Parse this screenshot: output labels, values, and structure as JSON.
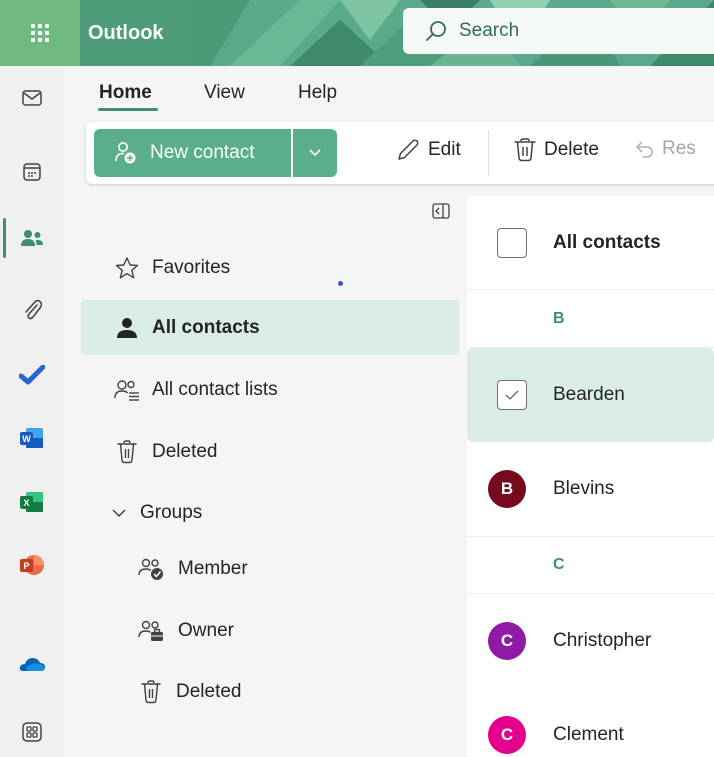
{
  "header": {
    "app_name": "Outlook",
    "search": {
      "label": "Search"
    }
  },
  "rail": {
    "items": [
      {
        "icon": "mail-icon"
      },
      {
        "icon": "calendar-icon"
      },
      {
        "icon": "people-icon",
        "active": true
      },
      {
        "icon": "attach-icon"
      },
      {
        "icon": "todo-icon"
      },
      {
        "icon": "word-icon",
        "letter": "W"
      },
      {
        "icon": "excel-icon",
        "letter": "X"
      },
      {
        "icon": "powerpoint-icon",
        "letter": "P"
      },
      {
        "icon": "onedrive-icon"
      },
      {
        "icon": "apps-icon"
      }
    ]
  },
  "tabs": [
    {
      "label": "Home",
      "selected": true
    },
    {
      "label": "View"
    },
    {
      "label": "Help"
    }
  ],
  "commands": {
    "new_contact": "New contact",
    "edit": "Edit",
    "delete": "Delete",
    "restore": "Res"
  },
  "nav": {
    "favorites": "Favorites",
    "all_contacts": "All contacts",
    "all_contact_lists": "All contact lists",
    "deleted": "Deleted",
    "groups": "Groups",
    "member": "Member",
    "owner": "Owner",
    "groups_deleted": "Deleted"
  },
  "list": {
    "header": "All contacts",
    "sections": [
      {
        "letter": "B"
      },
      {
        "letter": "C"
      }
    ],
    "contacts": [
      {
        "name": "Bearden",
        "selected": true
      },
      {
        "name": "Blevins",
        "initial": "B",
        "color": "#750b1c"
      },
      {
        "name": "Christopher",
        "initial": "C",
        "color": "#8e1aa5"
      },
      {
        "name": "Clement",
        "initial": "C",
        "color": "#e3008c"
      }
    ]
  },
  "colors": {
    "accent": "#3f8e6e",
    "header": "#5aa98a",
    "selected_bg": "#d9ede5"
  }
}
